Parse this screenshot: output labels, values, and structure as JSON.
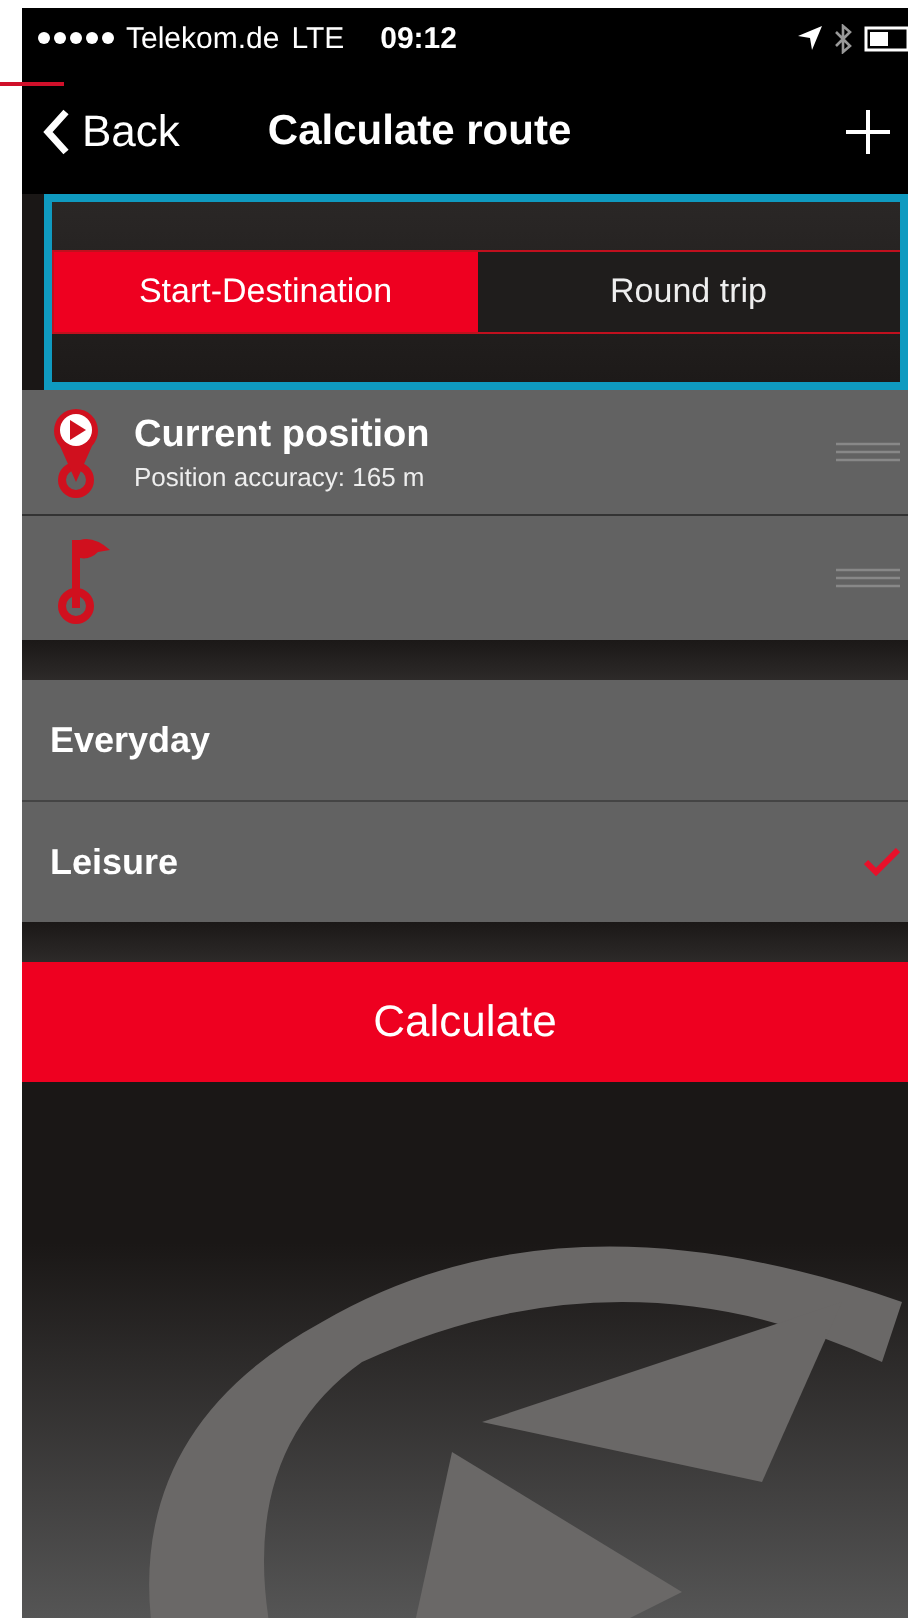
{
  "status_bar": {
    "carrier": "Telekom.de",
    "network": "LTE",
    "time": "09:12"
  },
  "nav_bar": {
    "back_label": "Back",
    "title": "Calculate route"
  },
  "tabs": [
    {
      "label": "Start-Destination",
      "selected": true
    },
    {
      "label": "Round trip",
      "selected": false
    }
  ],
  "waypoints": [
    {
      "kind": "start",
      "title": "Current position",
      "subtitle": "Position accuracy: 165 m"
    },
    {
      "kind": "destination"
    }
  ],
  "route_types": [
    {
      "label": "Everyday",
      "selected": false
    },
    {
      "label": "Leisure",
      "selected": true
    }
  ],
  "calculate_button": "Calculate"
}
